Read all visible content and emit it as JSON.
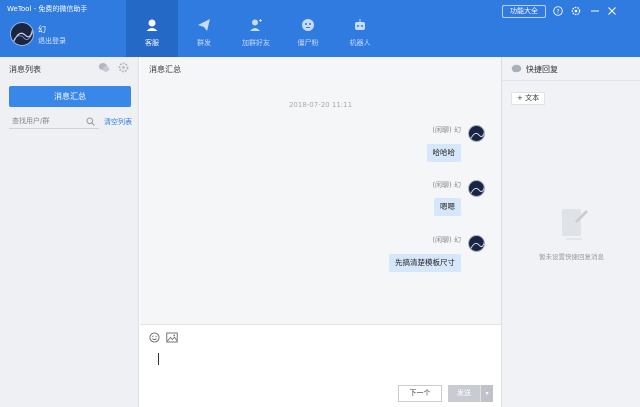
{
  "app": {
    "title": "WeTool - 免费的微信助手",
    "user_name": "幻",
    "logout_label": "退出登录",
    "feature_label": "功能大全"
  },
  "nav": [
    {
      "label": "客服",
      "icon": "headset-icon",
      "active": true
    },
    {
      "label": "群发",
      "icon": "paper-plane-icon",
      "active": false
    },
    {
      "label": "加群好友",
      "icon": "add-friend-icon",
      "active": false
    },
    {
      "label": "僵尸粉",
      "icon": "zombie-icon",
      "active": false
    },
    {
      "label": "机器人",
      "icon": "robot-icon",
      "active": false
    }
  ],
  "window_controls": [
    "help-icon",
    "settings-icon",
    "minimize-icon",
    "close-icon"
  ],
  "left": {
    "title": "消息列表",
    "summary_button": "消息汇总",
    "search_placeholder": "查找用户/群",
    "clear_list": "清空列表"
  },
  "center": {
    "title": "消息汇总",
    "timestamp": "2018-07-20 11:11",
    "messages": [
      {
        "meta": "(闲聊) 幻",
        "text": "哈哈哈"
      },
      {
        "meta": "(闲聊) 幻",
        "text": "嗯嗯"
      },
      {
        "meta": "(闲聊) 幻",
        "text": "先搞清楚模板尺寸"
      }
    ],
    "next_button": "下一个",
    "send_button": "发送",
    "send_dropdown": "▾"
  },
  "right": {
    "title": "快捷回复",
    "add_text_button": "+ 文本",
    "empty_text": "暂未设置快捷回复消息"
  },
  "colors": {
    "header_blue": "#2f7be0",
    "active_nav": "#2569c6",
    "primary_button": "#3a87ea",
    "bubble": "#d6e6fb"
  }
}
